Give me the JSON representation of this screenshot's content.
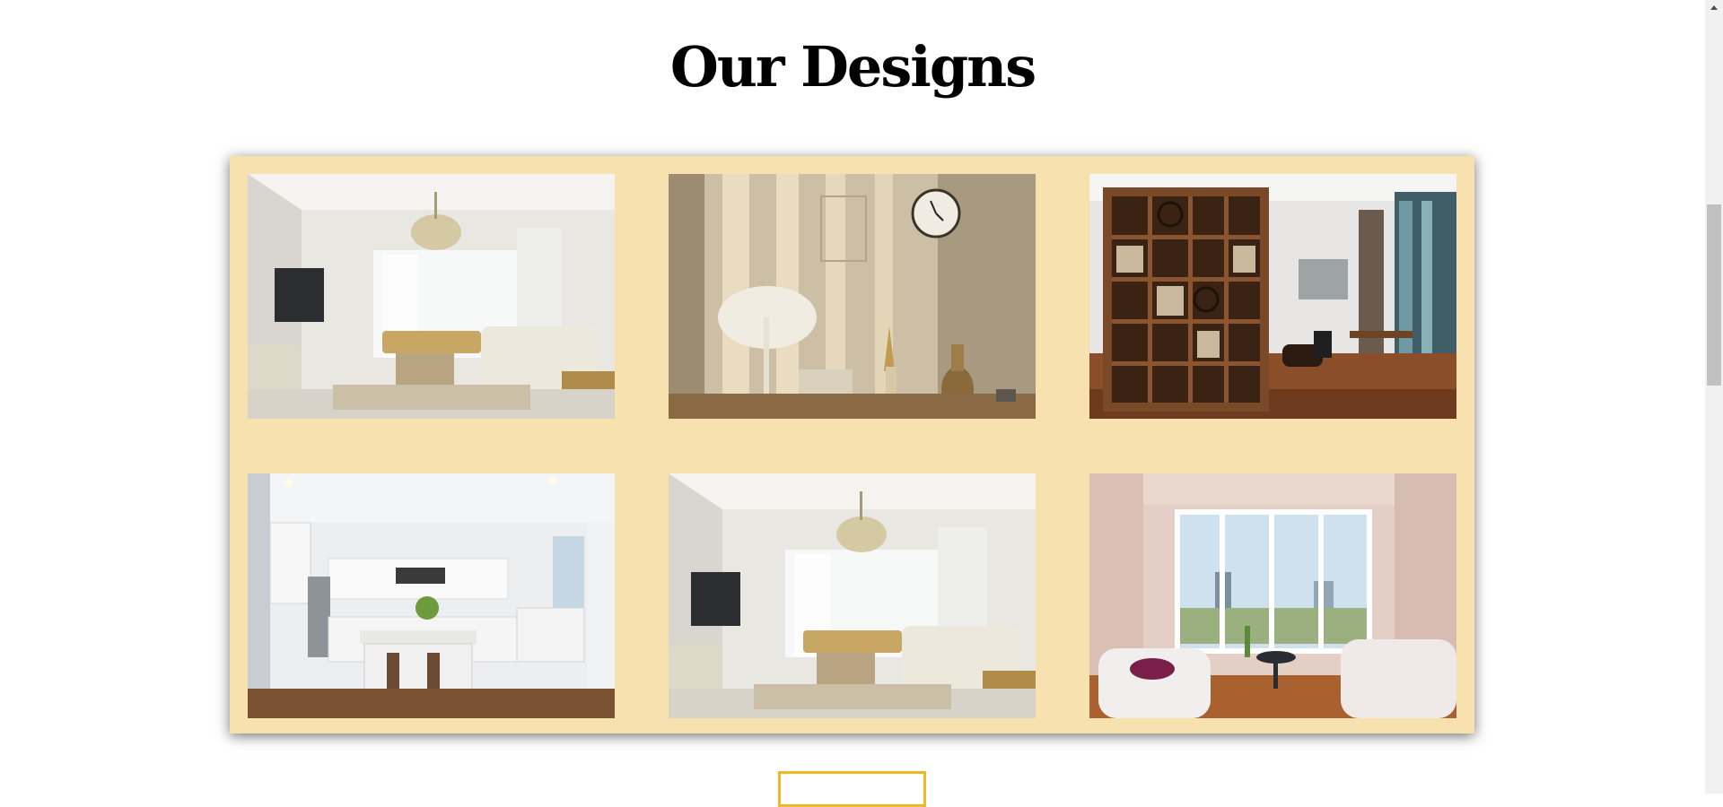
{
  "section": {
    "title": "Our Designs"
  },
  "gallery": {
    "items": [
      {
        "scene": "living-room-chandelier"
      },
      {
        "scene": "lamp-still-life"
      },
      {
        "scene": "bookshelf-office"
      },
      {
        "scene": "white-kitchen"
      },
      {
        "scene": "living-room-chandelier"
      },
      {
        "scene": "bay-window-lounge"
      }
    ]
  },
  "colors": {
    "panel": "#f7e2af",
    "button_border": "#f0b824"
  }
}
